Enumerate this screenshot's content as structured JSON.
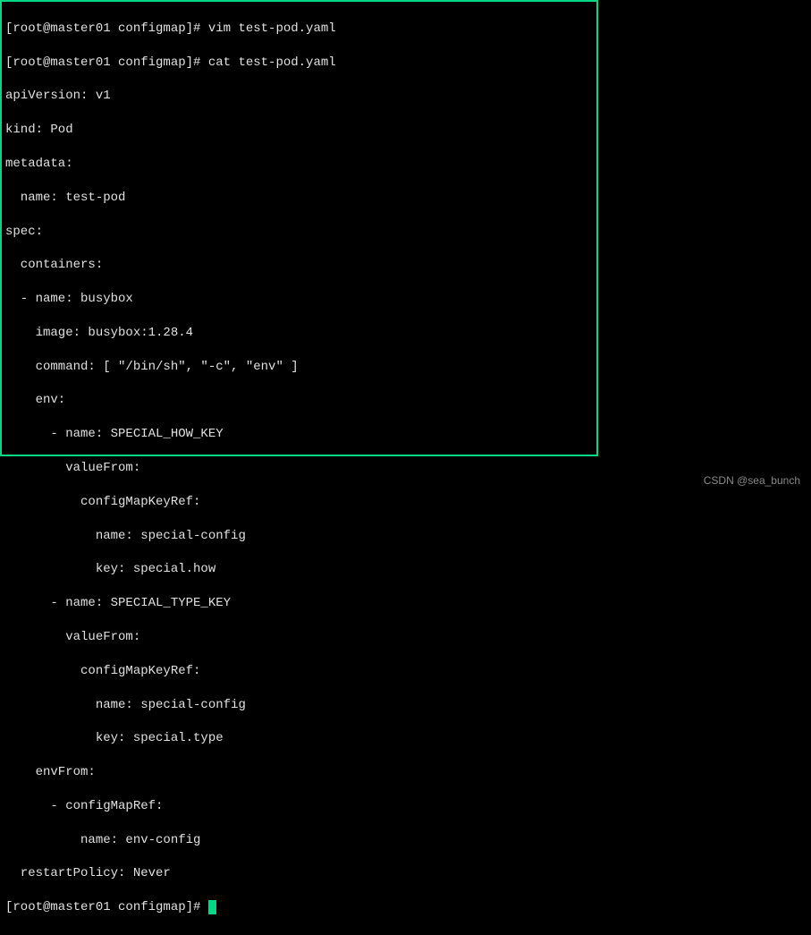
{
  "prompt1": "[root@master01 configmap]# ",
  "cmd1": "vim test-pod.yaml",
  "prompt2": "[root@master01 configmap]# ",
  "cmd2": "cat test-pod.yaml",
  "yaml": {
    "l01": "apiVersion: v1",
    "l02": "kind: Pod",
    "l03": "metadata:",
    "l04": "  name: test-pod",
    "l05": "spec:",
    "l06": "  containers:",
    "l07": "  - name: busybox",
    "l08": "    image: busybox:1.28.4",
    "l09": "    command: [ \"/bin/sh\", \"-c\", \"env\" ]",
    "l10": "    env:",
    "l11": "      - name: SPECIAL_HOW_KEY",
    "l12": "        valueFrom:",
    "l13": "          configMapKeyRef:",
    "l14": "            name: special-config",
    "l15": "            key: special.how",
    "l16": "      - name: SPECIAL_TYPE_KEY",
    "l17": "        valueFrom:",
    "l18": "          configMapKeyRef:",
    "l19": "            name: special-config",
    "l20": "            key: special.type",
    "l21": "    envFrom:",
    "l22": "      - configMapRef:",
    "l23": "          name: env-config",
    "l24": "  restartPolicy: Never"
  },
  "prompt3": "[root@master01 configmap]# ",
  "watermark": "CSDN @sea_bunch"
}
